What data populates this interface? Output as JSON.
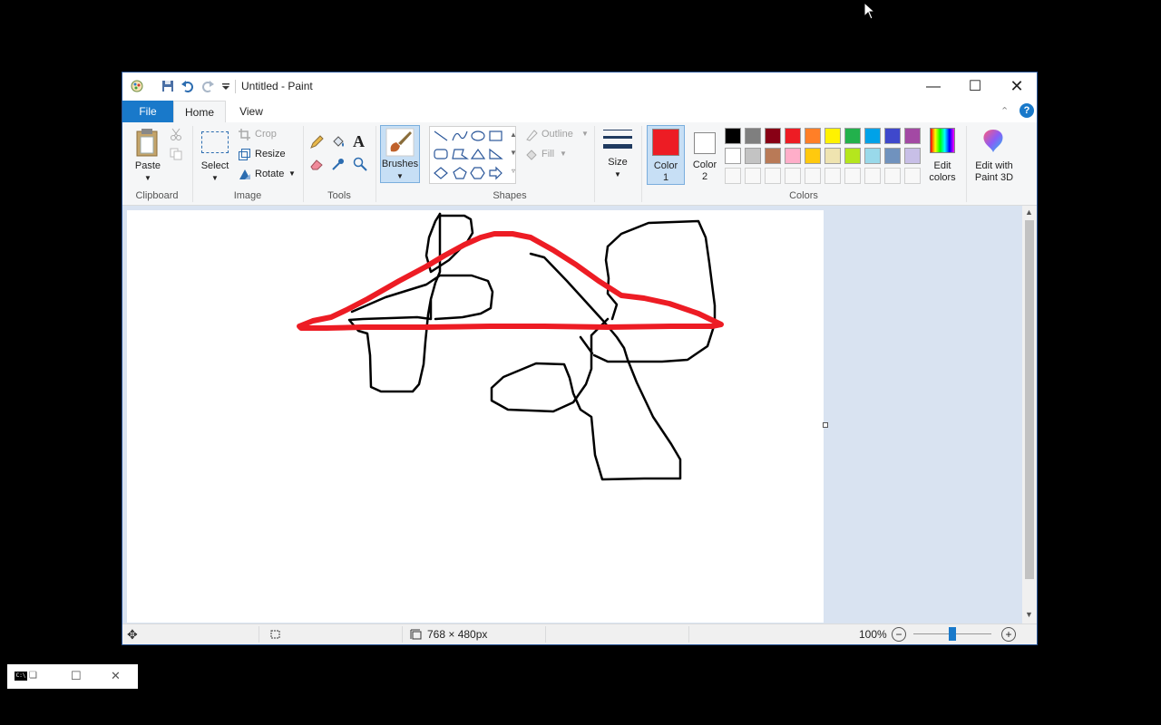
{
  "window": {
    "title": "Untitled - Paint"
  },
  "tabs": {
    "file": "File",
    "home": "Home",
    "view": "View"
  },
  "clipboard": {
    "paste": "Paste",
    "group": "Clipboard"
  },
  "image": {
    "select": "Select",
    "crop": "Crop",
    "resize": "Resize",
    "rotate": "Rotate",
    "group": "Image"
  },
  "tools": {
    "group": "Tools",
    "text_glyph": "A"
  },
  "brushes": {
    "label": "Brushes"
  },
  "shapes": {
    "outline": "Outline",
    "fill": "Fill",
    "group": "Shapes"
  },
  "size": {
    "label": "Size"
  },
  "color1": {
    "label": "Color",
    "num": "1",
    "value": "#ed1c24"
  },
  "color2": {
    "label": "Color",
    "num": "2",
    "value": "#ffffff"
  },
  "colors": {
    "group": "Colors",
    "row1": [
      "#000000",
      "#7f7f7f",
      "#880015",
      "#ed1c24",
      "#ff7f27",
      "#fff200",
      "#22b14c",
      "#00a2e8",
      "#3f48cc",
      "#a349a4"
    ],
    "row2": [
      "#ffffff",
      "#c3c3c3",
      "#b97a57",
      "#ffaec9",
      "#ffc90e",
      "#efe4b0",
      "#b5e61d",
      "#99d9ea",
      "#7092be",
      "#c8bfe7"
    ]
  },
  "edit_colors": {
    "line1": "Edit",
    "line2": "colors"
  },
  "paint3d": {
    "line1": "Edit with",
    "line2": "Paint 3D"
  },
  "status": {
    "size": "768 × 480px",
    "zoom": "100%"
  }
}
